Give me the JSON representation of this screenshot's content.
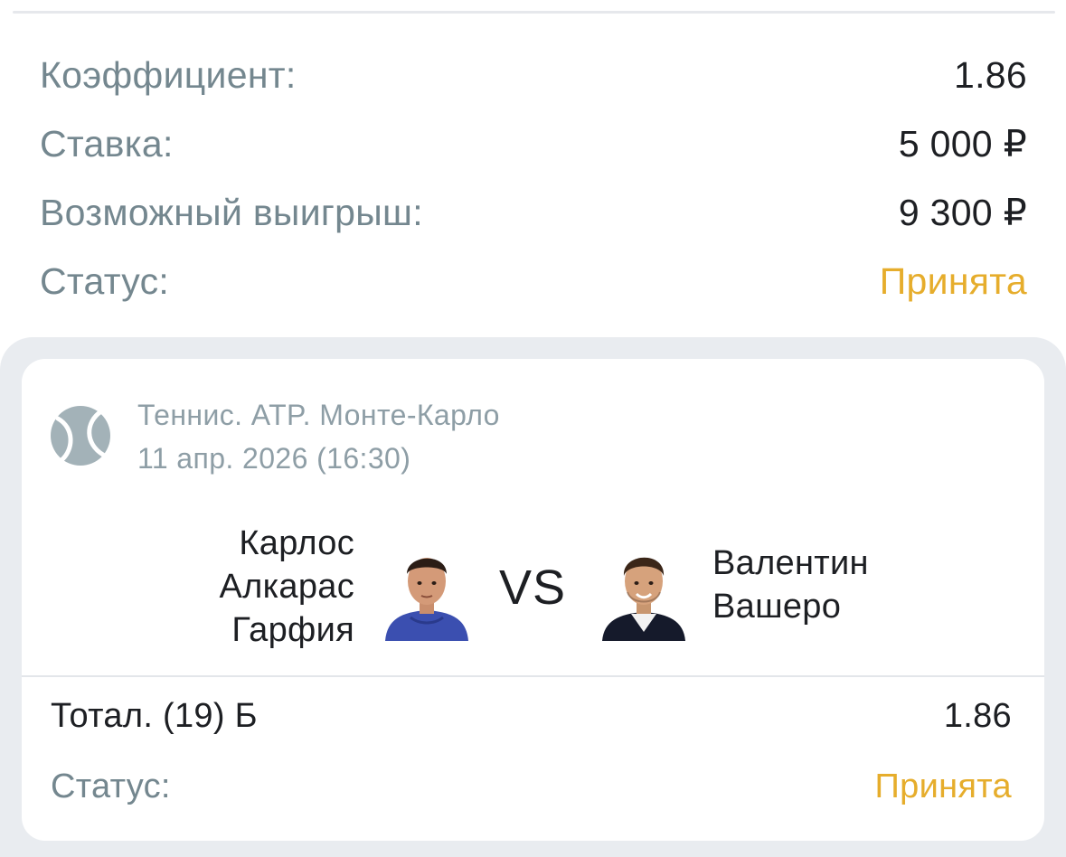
{
  "summary": {
    "odds_label": "Коэффициент:",
    "odds_value": "1.86",
    "stake_label": "Ставка:",
    "stake_value": "5 000 ₽",
    "payout_label": "Возможный выигрыш:",
    "payout_value": "9 300 ₽",
    "status_label": "Статус:",
    "status_value": "Принята"
  },
  "event": {
    "sport_icon": "tennis-ball-icon",
    "league": "Теннис. ATP. Монте-Карло",
    "date": "11 апр. 2026 (16:30)",
    "player_left": {
      "name_line1": "Карлос",
      "name_line2": "Алкарас",
      "name_line3": "Гарфия",
      "avatar_icon": "player-avatar-icon"
    },
    "vs": "VS",
    "player_right": {
      "name_line1": "Валентин",
      "name_line2": "Вашеро",
      "avatar_icon": "player-avatar-icon"
    }
  },
  "bet": {
    "market": "Тотал. (19) Б",
    "odds": "1.86",
    "status_label": "Статус:",
    "status_value": "Принята"
  },
  "colors": {
    "accent_status": "#e6ad2c",
    "label_gray": "#74878f",
    "text_dark": "#1d1f23",
    "card_background": "#e9ecf0"
  }
}
